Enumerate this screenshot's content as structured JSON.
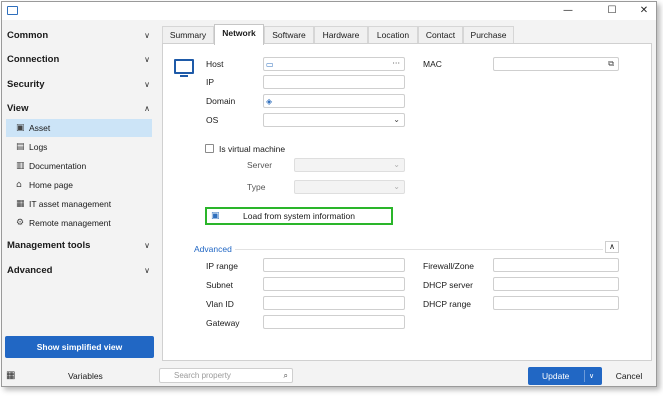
{
  "window": {
    "minimize_icon": "minimize-icon",
    "maximize_icon": "maximize-icon",
    "close_icon": "close-icon",
    "maximize_glyph": "☐",
    "close_glyph": "✕"
  },
  "sidebar": {
    "sections": [
      {
        "label": "Common",
        "expanded": false
      },
      {
        "label": "Connection",
        "expanded": false
      },
      {
        "label": "Security",
        "expanded": false
      },
      {
        "label": "View",
        "expanded": true
      },
      {
        "label": "Management tools",
        "expanded": false
      },
      {
        "label": "Advanced",
        "expanded": false
      }
    ],
    "view_items": [
      {
        "label": "Asset",
        "icon": "asset-icon",
        "glyph": "▣",
        "selected": true
      },
      {
        "label": "Logs",
        "icon": "logs-icon",
        "glyph": "▤",
        "selected": false
      },
      {
        "label": "Documentation",
        "icon": "documentation-icon",
        "glyph": "▥",
        "selected": false
      },
      {
        "label": "Home page",
        "icon": "home-icon",
        "glyph": "⌂",
        "selected": false
      },
      {
        "label": "IT asset management",
        "icon": "it-asset-management-icon",
        "glyph": "▦",
        "selected": false
      },
      {
        "label": "Remote management",
        "icon": "remote-management-icon",
        "glyph": "⚙",
        "selected": false
      }
    ],
    "simplified_button": "Show simplified view"
  },
  "tabs": [
    "Summary",
    "Network",
    "Software",
    "Hardware",
    "Location",
    "Contact",
    "Purchase"
  ],
  "active_tab": "Network",
  "network": {
    "host_label": "Host",
    "host_value": "",
    "host_more": "···",
    "ip_label": "IP",
    "ip_value": "",
    "domain_label": "Domain",
    "domain_value": "",
    "os_label": "OS",
    "os_value": "",
    "mac_label": "MAC",
    "mac_value": "",
    "is_virtual_label": "Is virtual machine",
    "is_virtual_checked": false,
    "server_label": "Server",
    "type_label": "Type",
    "load_button": "Load from system information"
  },
  "advanced": {
    "label": "Advanced",
    "expanded": true,
    "left_fields": [
      "IP range",
      "Subnet",
      "Vlan ID",
      "Gateway"
    ],
    "right_fields": [
      "Firewall/Zone",
      "DHCP server",
      "DHCP range"
    ]
  },
  "bottom": {
    "variables_label": "Variables",
    "search_placeholder": "Search property",
    "update_label": "Update",
    "cancel_label": "Cancel"
  },
  "colors": {
    "accent": "#2167c4",
    "highlight_border": "#2ab52a",
    "selected_bg": "#cce4f7"
  },
  "glyphs": {
    "chevron_down": "∨",
    "chevron_up": "∧",
    "dropdown": "⌄",
    "search": "⌕",
    "grid": "▦"
  }
}
